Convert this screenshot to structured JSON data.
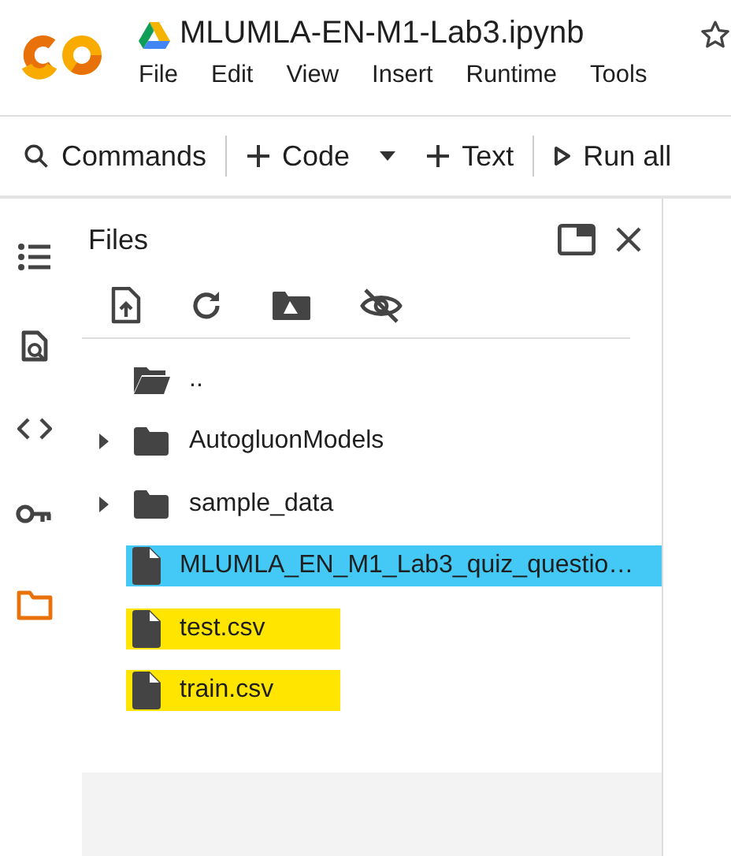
{
  "notebook": {
    "title": "MLUMLA-EN-M1-Lab3.ipynb",
    "starred": false
  },
  "menu": [
    "File",
    "Edit",
    "View",
    "Insert",
    "Runtime",
    "Tools"
  ],
  "toolbar": [
    {
      "kind": "search",
      "label": "Commands",
      "divider_after": true
    },
    {
      "kind": "add",
      "label": "Code",
      "dropdown": true,
      "divider_after": false
    },
    {
      "kind": "add",
      "label": "Text",
      "divider_after": true
    },
    {
      "kind": "run",
      "label": "Run all",
      "divider_after": false
    }
  ],
  "rail": [
    {
      "kind": "toc",
      "selected": false
    },
    {
      "kind": "find",
      "selected": false
    },
    {
      "kind": "code",
      "selected": false
    },
    {
      "kind": "key",
      "selected": false
    },
    {
      "kind": "files",
      "selected": true
    }
  ],
  "files": {
    "title": "Files",
    "entries": [
      {
        "kind": "parent",
        "name": ".."
      },
      {
        "kind": "folder",
        "name": "AutogluonModels",
        "expanded": false
      },
      {
        "kind": "folder",
        "name": "sample_data",
        "expanded": false
      },
      {
        "kind": "file",
        "name": "MLUMLA_EN_M1_Lab3_quiz_questio…",
        "color": "#44c8f5",
        "wide": true
      },
      {
        "kind": "file",
        "name": "test.csv",
        "color": "#ffe500",
        "wide": false
      },
      {
        "kind": "file",
        "name": "train.csv",
        "color": "#ffe500",
        "wide": false
      }
    ]
  }
}
